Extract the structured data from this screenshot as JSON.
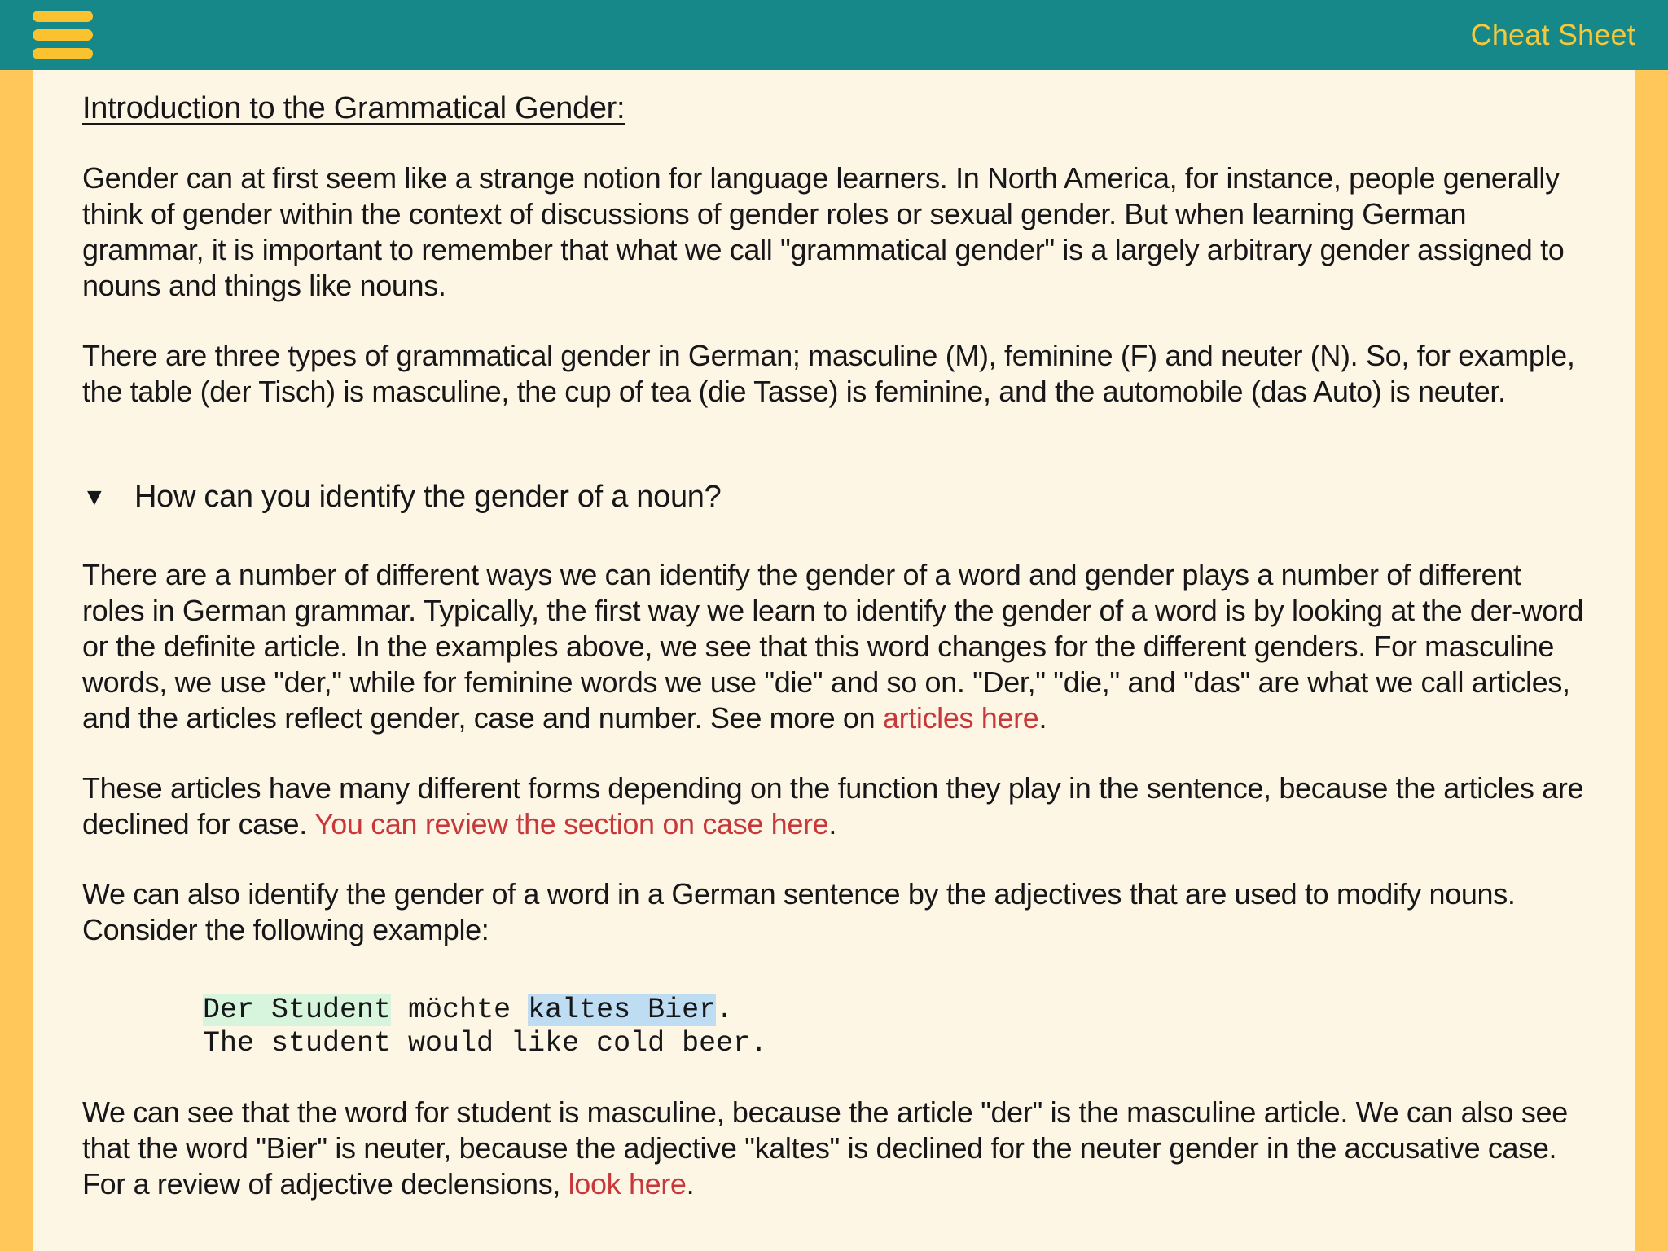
{
  "topbar": {
    "menu_icon": "hamburger-menu-icon",
    "title": "Cheat Sheet",
    "background_color": "#17888A",
    "accent_color": "#F5C93A"
  },
  "theme": {
    "page_border_color": "#FFC759",
    "content_background": "#FDF6E5",
    "link_color": "#C8383B",
    "text_color": "#17171A",
    "highlight_masculine": "#D6F5DC",
    "highlight_neuter": "#BFDDF2"
  },
  "document": {
    "heading": "Introduction to the Grammatical Gender:",
    "paragraph_1": "Gender can at first seem like a strange notion for language learners. In North America, for instance, people generally think of gender within the context of discussions of gender roles or sexual gender. But when learning German grammar, it is important to remember that what we call \"grammatical gender\" is a largely arbitrary gender assigned to nouns and things like nouns.",
    "paragraph_2": "There are three types of grammatical gender in German; masculine (M), feminine (F) and neuter (N). So, for example, the table (der Tisch) is masculine, the cup of tea (die Tasse) is feminine, and the automobile (das Auto) is neuter.",
    "collapsible": {
      "toggle_icon": "▼",
      "state": "expanded",
      "title": "How can you identify the gender of a noun?",
      "paragraph_3_part_1": "There are a number of different ways we can identify the gender of a word and gender plays a number of different roles in German grammar. Typically, the first way we learn to identify the gender of a word is by looking at the der-word or the definite article. In the examples above, we see that this word changes for the different genders. For masculine words, we use \"der,\" while for feminine words we use \"die\" and so on. \"Der,\" \"die,\" and \"das\" are what we call articles, and the articles reflect gender, case and number. See more on ",
      "paragraph_3_link": "articles here",
      "paragraph_3_part_2": ".",
      "paragraph_4_part_1": "These articles have many different forms depending on the function they play in the sentence, because the articles are declined for case. ",
      "paragraph_4_link": "You can review the section on case here",
      "paragraph_4_part_2": ".",
      "paragraph_5": "We can also identify the gender of a word in a German sentence by the adjectives that are used to modify nouns. Consider the following example:",
      "example": {
        "german_segment_1": "Der Student",
        "german_segment_2": " möchte ",
        "german_segment_3": "kaltes Bier",
        "german_segment_4": ".",
        "english_line": "The student would like cold beer."
      },
      "paragraph_6_part_1": "We can see that the word for student is masculine, because the article \"der\" is the masculine article. We can also see that the word \"Bier\" is neuter, because the adjective \"kaltes\" is declined for the neuter gender in the accusative case. For a review of adjective declensions, ",
      "paragraph_6_link": "look here",
      "paragraph_6_part_2": "."
    }
  }
}
